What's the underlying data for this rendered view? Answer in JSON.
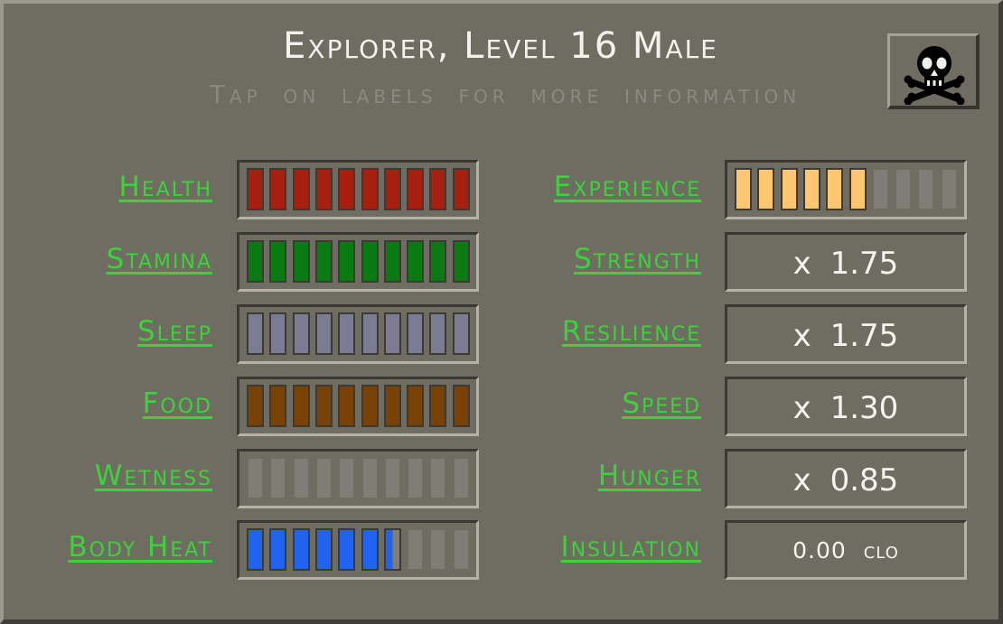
{
  "header": {
    "title": "Explorer, Level 16 Male",
    "subtitle": "Tap on labels for more information"
  },
  "skull_button": {
    "icon": "skull-crossbones-icon"
  },
  "left_stats": [
    {
      "label": "Health",
      "filled": 10,
      "total": 10,
      "color": "#a71f0d"
    },
    {
      "label": "Stamina",
      "filled": 10,
      "total": 10,
      "color": "#0a7a12"
    },
    {
      "label": "Sleep",
      "filled": 10,
      "total": 10,
      "color": "#7b7b94"
    },
    {
      "label": "Food",
      "filled": 10,
      "total": 10,
      "color": "#7a4106"
    },
    {
      "label": "Wetness",
      "filled": 0,
      "total": 10,
      "color": "#7f7d75"
    },
    {
      "label": "Body Heat",
      "filled": 6.5,
      "total": 10,
      "color": "#1f63f0"
    }
  ],
  "right_stats": [
    {
      "label": "Experience",
      "type": "bar",
      "filled": 6,
      "total": 10,
      "color": "#ffc671"
    },
    {
      "label": "Strength",
      "type": "value",
      "value": "x 1.75"
    },
    {
      "label": "Resilience",
      "type": "value",
      "value": "x 1.75"
    },
    {
      "label": "Speed",
      "type": "value",
      "value": "x 1.30"
    },
    {
      "label": "Hunger",
      "type": "value",
      "value": "x 0.85"
    },
    {
      "label": "Insulation",
      "type": "value",
      "value": "0.00 clo",
      "small": true
    }
  ],
  "colors": {
    "panel_bg": "#6f6c62",
    "label_green": "#3ed13e",
    "empty_segment": "#7f7d75"
  }
}
